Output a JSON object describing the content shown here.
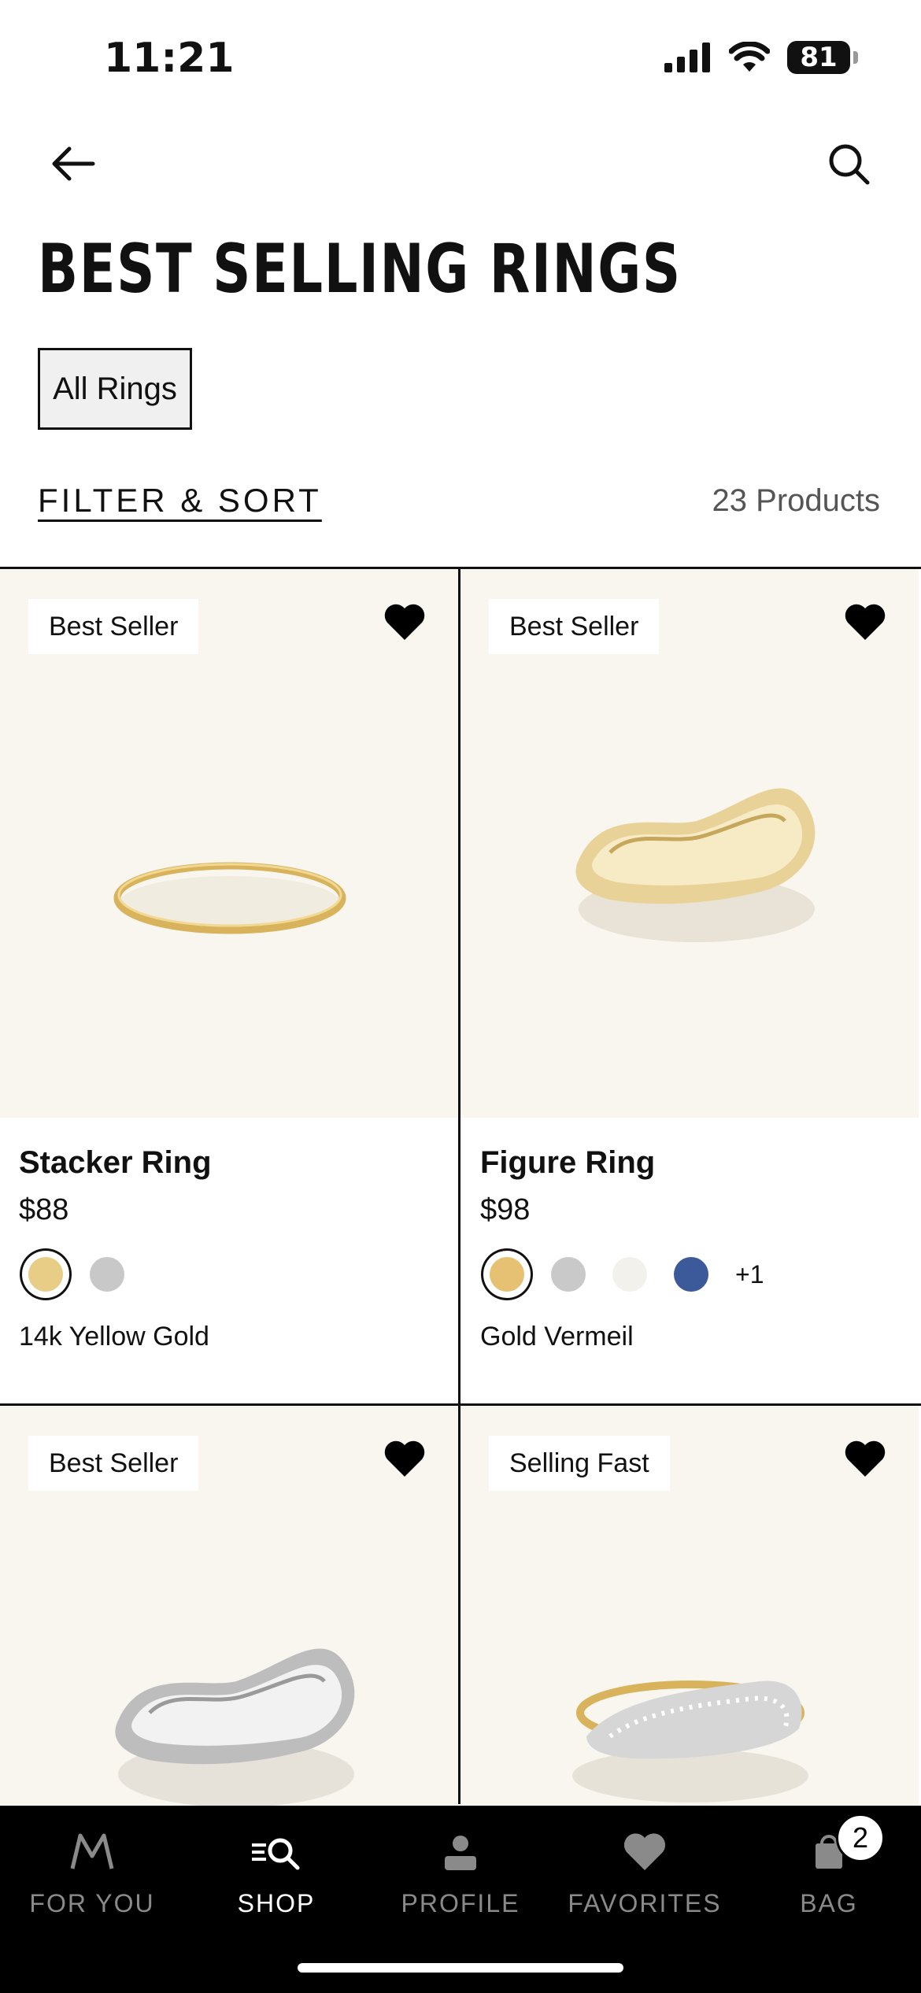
{
  "status": {
    "time": "11:21",
    "battery": "81"
  },
  "header": {
    "title": "BEST SELLING RINGS",
    "chip": "All Rings",
    "filter_sort": "FILTER & SORT",
    "count": "23 Products"
  },
  "products": [
    {
      "badge": "Best Seller",
      "name": "Stacker Ring",
      "price": "$88",
      "metal": "14k Yellow Gold",
      "swatches": [
        "#e8cd86",
        "#c8c8c8"
      ],
      "more": ""
    },
    {
      "badge": "Best Seller",
      "name": "Figure Ring",
      "price": "$98",
      "metal": "Gold Vermeil",
      "swatches": [
        "#e6c174",
        "#c9c9c9",
        "#f3f1ec",
        "#3c5a99"
      ],
      "more": "+1"
    },
    {
      "badge": "Best Seller"
    },
    {
      "badge": "Selling Fast"
    }
  ],
  "tabbar": {
    "items": [
      {
        "label": "FOR YOU",
        "icon": "m-logo-icon"
      },
      {
        "label": "SHOP",
        "icon": "shop-search-icon"
      },
      {
        "label": "PROFILE",
        "icon": "person-icon"
      },
      {
        "label": "FAVORITES",
        "icon": "heart-icon"
      },
      {
        "label": "BAG",
        "icon": "bag-icon"
      }
    ],
    "bag_count": "2"
  },
  "colors": {
    "image_bg": "#f8f6ef",
    "tab_bg": "#000000",
    "accent": "#111111"
  }
}
